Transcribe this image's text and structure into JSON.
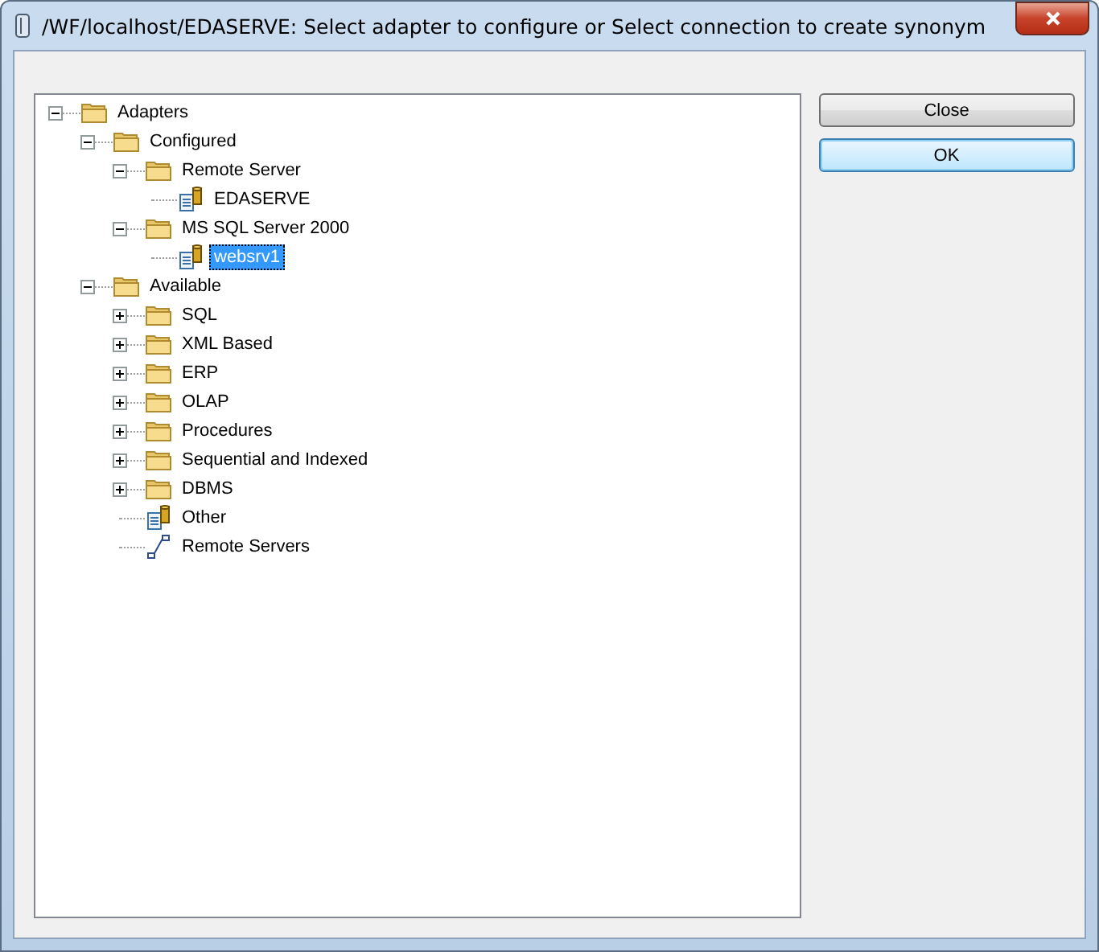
{
  "window": {
    "title": "/WF/localhost/EDASERVE: Select adapter to configure or Select connection to create synonym"
  },
  "tree": [
    {
      "label": "Adapters",
      "kind": "folder",
      "expanded": true,
      "selected": false,
      "children": [
        {
          "label": "Configured",
          "kind": "folder",
          "expanded": true,
          "selected": false,
          "children": [
            {
              "label": "Remote Server",
              "kind": "folder",
              "expanded": true,
              "selected": false,
              "children": [
                {
                  "label": "EDASERVE",
                  "kind": "adapter",
                  "selected": false
                }
              ]
            },
            {
              "label": "MS SQL Server 2000",
              "kind": "folder",
              "expanded": true,
              "selected": false,
              "children": [
                {
                  "label": "websrv1",
                  "kind": "adapter",
                  "selected": true
                }
              ]
            }
          ]
        },
        {
          "label": "Available",
          "kind": "folder",
          "expanded": true,
          "selected": false,
          "children": [
            {
              "label": "SQL",
              "kind": "folder",
              "expanded": false,
              "selected": false
            },
            {
              "label": "XML Based",
              "kind": "folder",
              "expanded": false,
              "selected": false
            },
            {
              "label": "ERP",
              "kind": "folder",
              "expanded": false,
              "selected": false
            },
            {
              "label": "OLAP",
              "kind": "folder",
              "expanded": false,
              "selected": false
            },
            {
              "label": "Procedures",
              "kind": "folder",
              "expanded": false,
              "selected": false
            },
            {
              "label": "Sequential and Indexed",
              "kind": "folder",
              "expanded": false,
              "selected": false
            },
            {
              "label": "DBMS",
              "kind": "folder",
              "expanded": false,
              "selected": false
            },
            {
              "label": "Other",
              "kind": "adapter",
              "selected": false
            },
            {
              "label": "Remote Servers",
              "kind": "link",
              "selected": false
            }
          ]
        }
      ]
    }
  ],
  "buttons": [
    {
      "label": "Close",
      "kind": "normal"
    },
    {
      "label": "OK",
      "kind": "default"
    }
  ]
}
